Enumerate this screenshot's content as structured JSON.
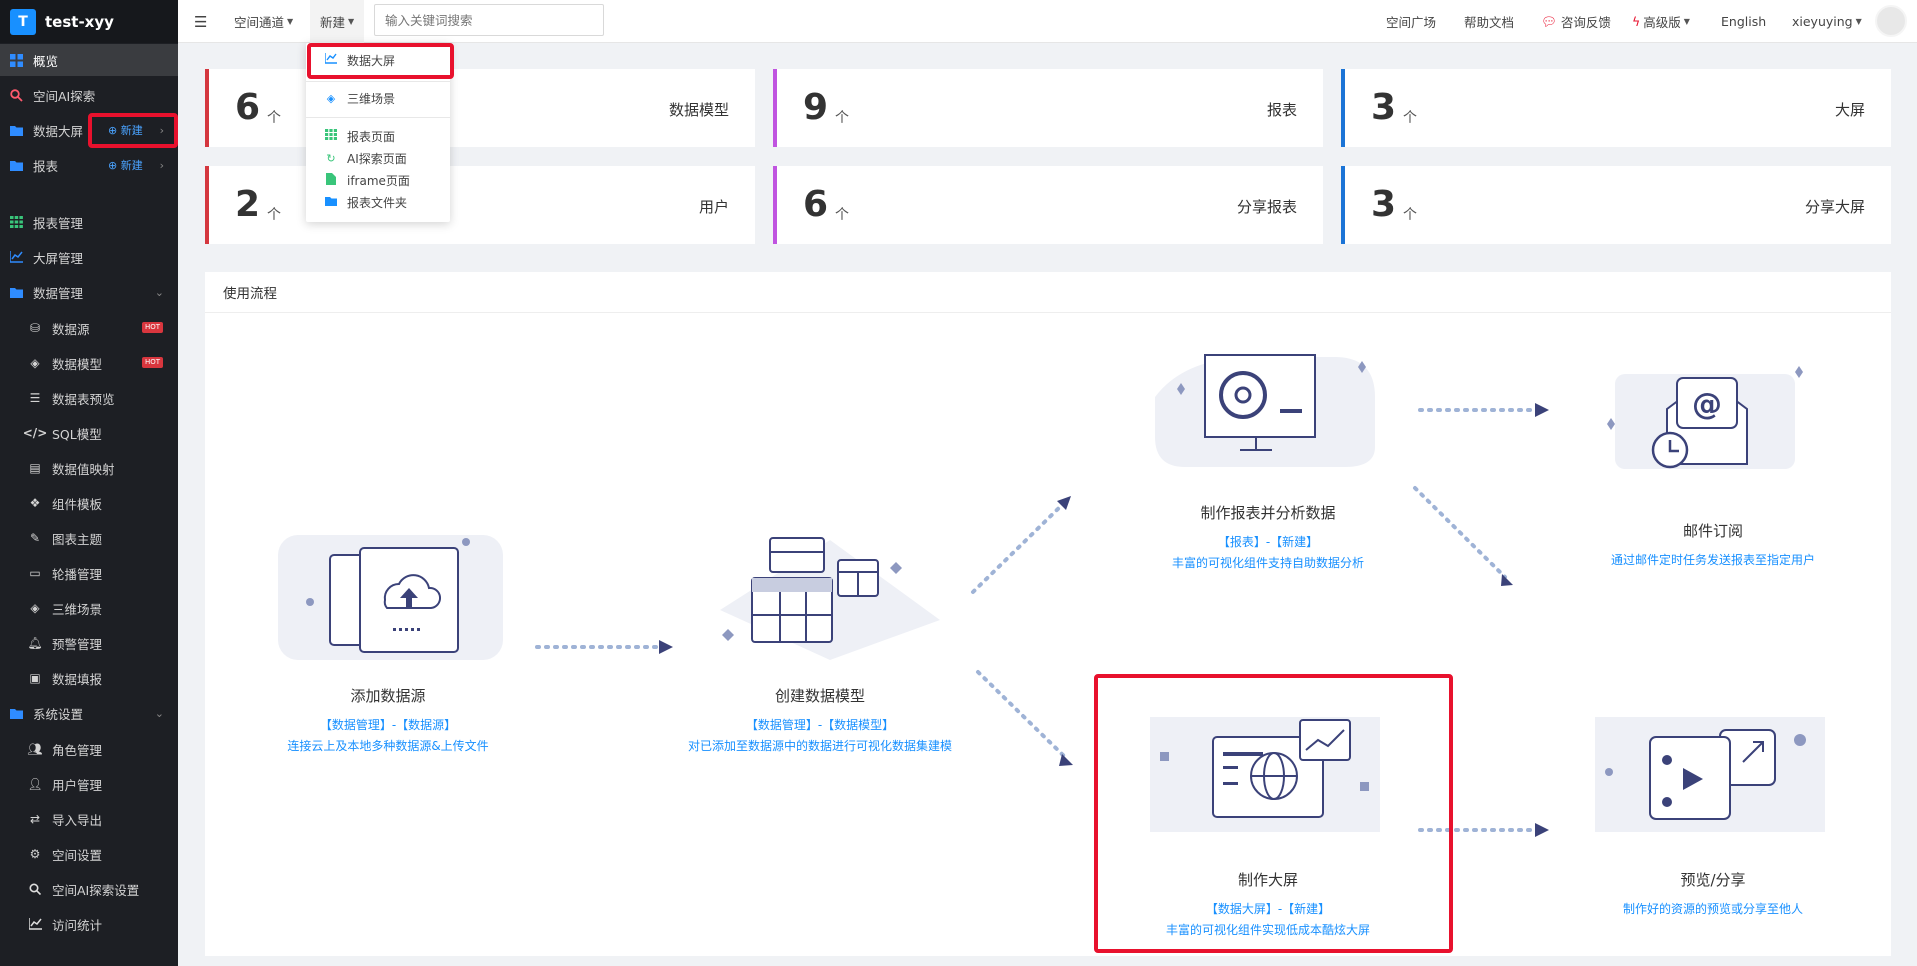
{
  "app": {
    "logo_letter": "T",
    "name": "test-xyy"
  },
  "sidebar": {
    "items": [
      {
        "label": "概览",
        "icon": "grid-icon"
      },
      {
        "label": "空间AI探索",
        "icon": "search-icon"
      },
      {
        "label": "数据大屏",
        "icon": "folder-icon",
        "new": "新建"
      },
      {
        "label": "报表",
        "icon": "folder-icon",
        "new": "新建"
      },
      {
        "label": "报表管理",
        "icon": "table-icon"
      },
      {
        "label": "大屏管理",
        "icon": "chart-icon"
      },
      {
        "label": "数据管理",
        "icon": "folder-icon"
      },
      {
        "label": "数据源",
        "icon": "database-icon",
        "badge": "HOT"
      },
      {
        "label": "数据模型",
        "icon": "cube-icon",
        "badge": "HOT"
      },
      {
        "label": "数据表预览",
        "icon": "list-icon"
      },
      {
        "label": "SQL模型",
        "icon": "code-icon"
      },
      {
        "label": "数据值映射",
        "icon": "book-icon"
      },
      {
        "label": "组件模板",
        "icon": "components-icon"
      },
      {
        "label": "图表主题",
        "icon": "brush-icon"
      },
      {
        "label": "轮播管理",
        "icon": "monitor-icon"
      },
      {
        "label": "三维场景",
        "icon": "cube-icon"
      },
      {
        "label": "预警管理",
        "icon": "bell-icon"
      },
      {
        "label": "数据填报",
        "icon": "form-icon"
      },
      {
        "label": "系统设置",
        "icon": "folder-icon"
      },
      {
        "label": "角色管理",
        "icon": "users-icon"
      },
      {
        "label": "用户管理",
        "icon": "user-icon"
      },
      {
        "label": "导入导出",
        "icon": "swap-icon"
      },
      {
        "label": "空间设置",
        "icon": "gear-icon"
      },
      {
        "label": "空间AI探索设置",
        "icon": "search-icon"
      },
      {
        "label": "访问统计",
        "icon": "chart-icon"
      }
    ]
  },
  "topbar": {
    "space_channel": "空间通道",
    "new_menu": "新建",
    "search_placeholder": "输入关键词搜索",
    "space_square": "空间广场",
    "help_docs": "帮助文档",
    "feedback": "咨询反馈",
    "edition": "高级版",
    "language": "English",
    "username": "xieyuying"
  },
  "new_dropdown": {
    "items": [
      {
        "label": "数据大屏",
        "icon": "chart-icon"
      },
      {
        "label": "三维场景",
        "icon": "cube-icon"
      },
      {
        "label": "报表页面",
        "icon": "table-icon"
      },
      {
        "label": "AI探索页面",
        "icon": "refresh-icon"
      },
      {
        "label": "iframe页面",
        "icon": "file-icon"
      },
      {
        "label": "报表文件夹",
        "icon": "folder-icon"
      }
    ]
  },
  "stats": [
    {
      "num": "6",
      "unit": "个",
      "label": "数据模型",
      "color": "#d4373f"
    },
    {
      "num": "9",
      "unit": "个",
      "label": "报表",
      "color": "#c054e0"
    },
    {
      "num": "3",
      "unit": "个",
      "label": "大屏",
      "color": "#1b74d6"
    },
    {
      "num": "2",
      "unit": "个",
      "label": "用户",
      "color": "#d4373f"
    },
    {
      "num": "6",
      "unit": "个",
      "label": "分享报表",
      "color": "#c054e0"
    },
    {
      "num": "3",
      "unit": "个",
      "label": "分享大屏",
      "color": "#1b74d6"
    }
  ],
  "flow": {
    "title": "使用流程",
    "steps": [
      {
        "title": "添加数据源",
        "link": "【数据管理】-【数据源】",
        "desc": "连接云上及本地多种数据源&上传文件"
      },
      {
        "title": "创建数据模型",
        "link": "【数据管理】-【数据模型】",
        "desc": "对已添加至数据源中的数据进行可视化数据集建模"
      },
      {
        "title": "制作报表并分析数据",
        "link": "【报表】-【新建】",
        "desc": "丰富的可视化组件支持自助数据分析"
      },
      {
        "title": "邮件订阅",
        "link": "通过邮件定时任务发送报表至指定用户",
        "desc": ""
      },
      {
        "title": "制作大屏",
        "link": "【数据大屏】-【新建】",
        "desc": "丰富的可视化组件实现低成本酷炫大屏"
      },
      {
        "title": "预览/分享",
        "link": "制作好的资源的预览或分享至他人",
        "desc": ""
      }
    ]
  },
  "colors": {
    "accent": "#1890ff",
    "sidebar_bg": "#1d1f24",
    "highlight": "#e8112d",
    "illus": "#3b4279"
  }
}
